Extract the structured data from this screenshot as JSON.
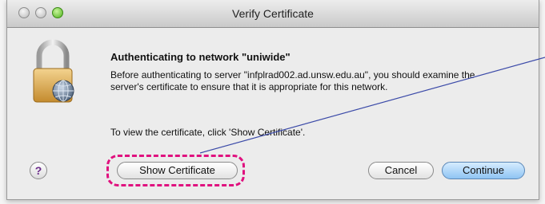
{
  "window": {
    "title": "Verify Certificate"
  },
  "content": {
    "heading": "Authenticating to network \"uniwide\"",
    "paragraph": "Before authenticating to server \"infplrad002.ad.unsw.edu.au\", you should examine the server's certificate to ensure that it is appropriate for this network.",
    "instruction": "To view the certificate, click 'Show Certificate'."
  },
  "buttons": {
    "help": "?",
    "show_certificate": "Show Certificate",
    "cancel": "Cancel",
    "continue": "Continue"
  },
  "colors": {
    "annotation": "#e0117f",
    "default_button": "#8fc4f3"
  },
  "icons": [
    "padlock-globe-icon",
    "help-icon"
  ]
}
